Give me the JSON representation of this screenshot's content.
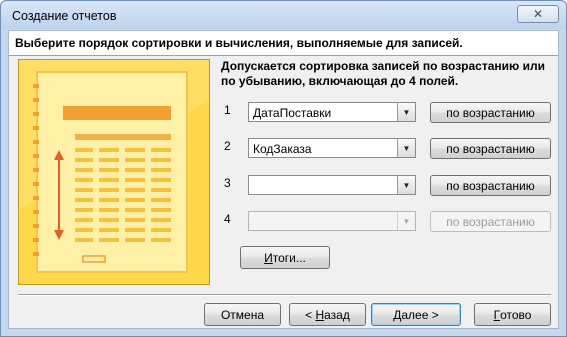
{
  "window": {
    "title": "Создание отчетов",
    "close_glyph": "✕"
  },
  "instruction": "Выберите порядок сортировки и вычисления, выполняемые для записей.",
  "hint": "Допускается сортировка записей по возрастанию или по убыванию, включающая до 4 полей.",
  "sort_rows": [
    {
      "number": "1",
      "field": "ДатаПоставки",
      "order_label": "по возрастанию",
      "enabled": true
    },
    {
      "number": "2",
      "field": "КодЗаказа",
      "order_label": "по возрастанию",
      "enabled": true
    },
    {
      "number": "3",
      "field": "",
      "order_label": "по возрастанию",
      "enabled": true
    },
    {
      "number": "4",
      "field": "",
      "order_label": "по возрастанию",
      "enabled": false
    }
  ],
  "summary_button": {
    "label_underlined": "И",
    "label_rest": "тоги..."
  },
  "footer_buttons": {
    "cancel": "Отмена",
    "back_prefix": "< ",
    "back_underlined": "Н",
    "back_rest": "азад",
    "next_underlined": "Д",
    "next_rest": "алее >",
    "finish_underlined": "Г",
    "finish_rest": "отово"
  },
  "colors": {
    "illustration_bg": "#ffd84a",
    "illustration_page": "#fff0a8",
    "illustration_accent": "#f0a030"
  }
}
